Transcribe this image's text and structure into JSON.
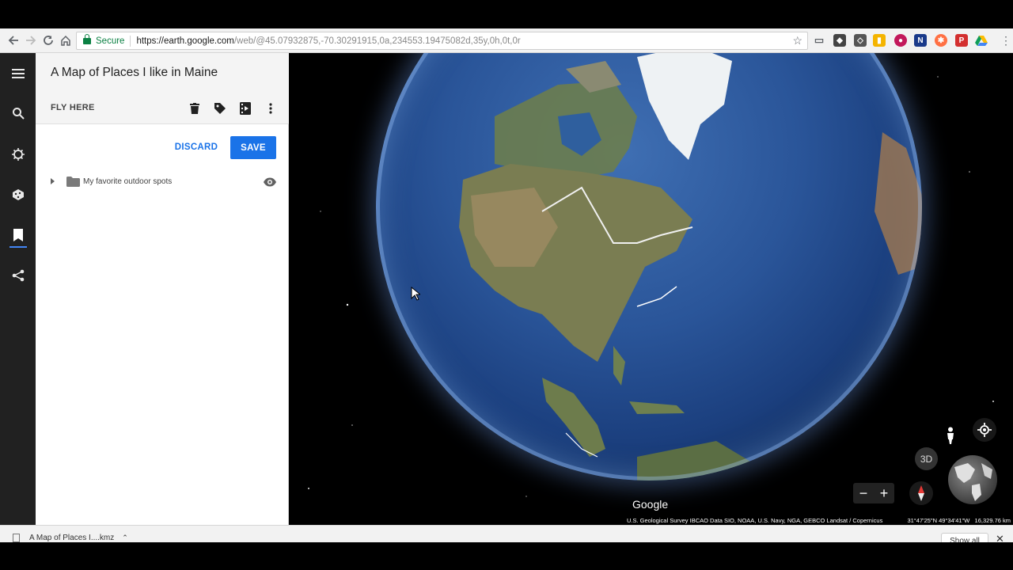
{
  "browser": {
    "secure_label": "Secure",
    "url_host": "https://earth.google.com",
    "url_path": "/web/@45.07932875,-70.30291915,0a,234553.19475082d,35y,0h,0t,0r"
  },
  "rail": {
    "items": [
      "menu-icon",
      "search-icon",
      "voyager-icon",
      "feeling-lucky-icon",
      "projects-icon",
      "share-icon"
    ],
    "active": "projects-icon"
  },
  "panel": {
    "title": "A Map of Places I like in Maine",
    "fly_here": "FLY HERE",
    "discard_label": "DISCARD",
    "save_label": "SAVE",
    "folder_label": "My favorite outdoor spots"
  },
  "map": {
    "logo": "Google",
    "attribution": "U.S. Geological Survey   IBCAO   Data SIO, NOAA, U.S. Navy, NGA, GEBCO   Landsat / Copernicus",
    "coords": "31°47'25\"N 49°34'41\"W",
    "scale": "16,329.76 km",
    "btn_3d": "3D",
    "zoom_out": "−",
    "zoom_in": "+"
  },
  "downloads": {
    "file_label": "A Map of Places I....kmz",
    "show_all": "Show all"
  },
  "colors": {
    "accent": "#1a73e8",
    "rail_bg": "#212121",
    "secure_green": "#0b8043"
  }
}
